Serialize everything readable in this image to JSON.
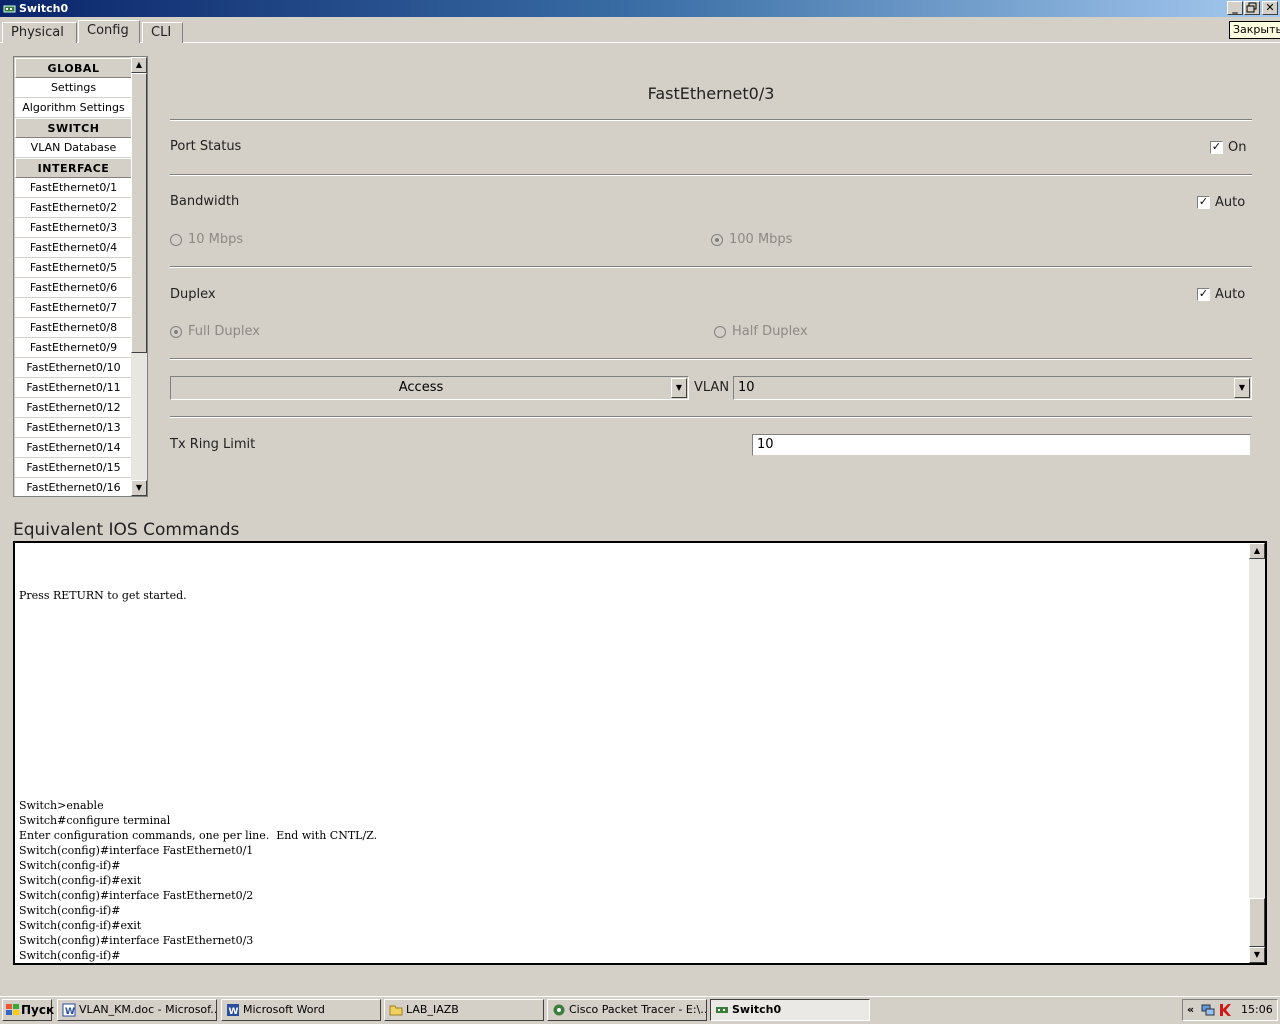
{
  "window": {
    "title": "Switch0",
    "tooltip": "Закрыть"
  },
  "tabs": [
    "Physical",
    "Config",
    "CLI"
  ],
  "active_tab": "Config",
  "left_list": {
    "global_header": "GLOBAL",
    "global_items": [
      "Settings",
      "Algorithm Settings"
    ],
    "switch_header": "SWITCH",
    "switch_items": [
      "VLAN Database"
    ],
    "interface_header": "INTERFACE",
    "interface_items": [
      "FastEthernet0/1",
      "FastEthernet0/2",
      "FastEthernet0/3",
      "FastEthernet0/4",
      "FastEthernet0/5",
      "FastEthernet0/6",
      "FastEthernet0/7",
      "FastEthernet0/8",
      "FastEthernet0/9",
      "FastEthernet0/10",
      "FastEthernet0/11",
      "FastEthernet0/12",
      "FastEthernet0/13",
      "FastEthernet0/14",
      "FastEthernet0/15",
      "FastEthernet0/16"
    ]
  },
  "port": {
    "title": "FastEthernet0/3",
    "port_status_label": "Port Status",
    "port_status_on_label": "On",
    "port_status_on": true,
    "bandwidth_label": "Bandwidth",
    "bandwidth_auto_label": "Auto",
    "bandwidth_auto": true,
    "bw_10_label": "10 Mbps",
    "bw_100_label": "100 Mbps",
    "bw_selected": "100 Mbps",
    "duplex_label": "Duplex",
    "duplex_auto_label": "Auto",
    "duplex_auto": true,
    "full_duplex_label": "Full Duplex",
    "half_duplex_label": "Half Duplex",
    "duplex_selected": "Full Duplex",
    "mode_value": "Access",
    "vlan_label": "VLAN",
    "vlan_value": "10",
    "tx_ring_label": "Tx Ring Limit",
    "tx_ring_value": "10"
  },
  "ios": {
    "title": "Equivalent IOS Commands",
    "console_text": "\n\n\nPress RETURN to get started.\n\n\n\n\n\n\n\n\n\n\n\n\n\nSwitch>enable\nSwitch#configure terminal\nEnter configuration commands, one per line.  End with CNTL/Z.\nSwitch(config)#interface FastEthernet0/1\nSwitch(config-if)#\nSwitch(config-if)#exit\nSwitch(config)#interface FastEthernet0/2\nSwitch(config-if)#\nSwitch(config-if)#exit\nSwitch(config)#interface FastEthernet0/3\nSwitch(config-if)#"
  },
  "taskbar": {
    "start_label": "Пуск",
    "items": [
      "VLAN_KM.doc - Microsof...",
      "Microsoft Word",
      "LAB_IAZB",
      "Cisco Packet Tracer - E:\\...",
      "Switch0"
    ],
    "active_item": "Switch0",
    "tray_expand": "«",
    "clock": "15:06"
  },
  "colors": {
    "title_bar_start": "#0a246a",
    "title_bar_end": "#a6caf0",
    "face": "#d4d0c8"
  }
}
